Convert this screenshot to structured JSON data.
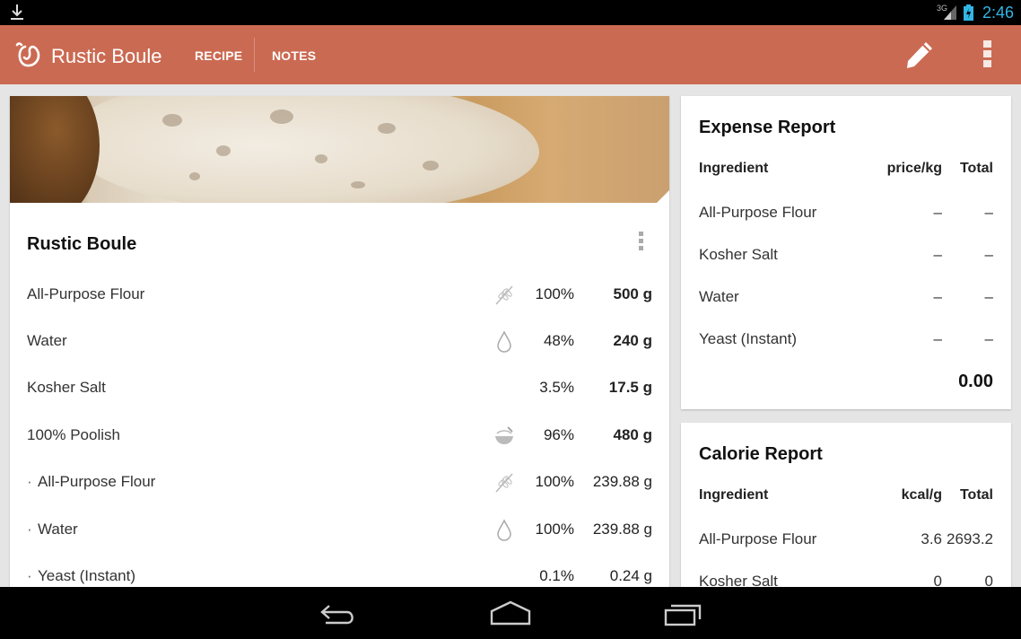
{
  "status_bar": {
    "network_label": "3G",
    "time": "2:46"
  },
  "action_bar": {
    "title": "Rustic Boule",
    "tabs": [
      {
        "label": "RECIPE"
      },
      {
        "label": "NOTES"
      }
    ],
    "icons": {
      "logo": "app-logo-icon",
      "edit": "pencil-icon",
      "overflow": "overflow-menu-icon"
    },
    "color": "#cb6a52"
  },
  "recipe": {
    "title": "Rustic Boule",
    "ingredients": [
      {
        "name": "All-Purpose Flour",
        "bullet": "",
        "icon": "wheat-icon",
        "percent": "100%",
        "weight": "500 g",
        "bold": true
      },
      {
        "name": "Water",
        "bullet": "",
        "icon": "water-drop-icon",
        "percent": "48%",
        "weight": "240 g",
        "bold": true
      },
      {
        "name": "Kosher Salt",
        "bullet": "",
        "icon": "",
        "percent": "3.5%",
        "weight": "17.5 g",
        "bold": true
      },
      {
        "name": "100% Poolish",
        "bullet": "",
        "icon": "preferment-bowl-icon",
        "percent": "96%",
        "weight": "480 g",
        "bold": true
      },
      {
        "name": "All-Purpose Flour",
        "bullet": "·",
        "icon": "wheat-icon",
        "percent": "100%",
        "weight": "239.88 g",
        "bold": false
      },
      {
        "name": "Water",
        "bullet": "·",
        "icon": "water-drop-icon",
        "percent": "100%",
        "weight": "239.88 g",
        "bold": false
      },
      {
        "name": "Yeast (Instant)",
        "bullet": "·",
        "icon": "",
        "percent": "0.1%",
        "weight": "0.24 g",
        "bold": false
      }
    ]
  },
  "expense_report": {
    "title": "Expense Report",
    "headers": [
      "Ingredient",
      "price/kg",
      "Total"
    ],
    "rows": [
      {
        "ingredient": "All-Purpose Flour",
        "price": "–",
        "total": "–"
      },
      {
        "ingredient": "Kosher Salt",
        "price": "–",
        "total": "–"
      },
      {
        "ingredient": "Water",
        "price": "–",
        "total": "–"
      },
      {
        "ingredient": "Yeast (Instant)",
        "price": "–",
        "total": "–"
      }
    ],
    "grand_total": "0.00"
  },
  "calorie_report": {
    "title": "Calorie Report",
    "headers": [
      "Ingredient",
      "kcal/g",
      "Total"
    ],
    "rows": [
      {
        "ingredient": "All-Purpose Flour",
        "kcal": "3.6",
        "total": "2693.2"
      },
      {
        "ingredient": "Kosher Salt",
        "kcal": "0",
        "total": "0"
      }
    ]
  },
  "nav_bar": {
    "icons": [
      "back-icon",
      "home-icon",
      "recent-apps-icon"
    ]
  }
}
